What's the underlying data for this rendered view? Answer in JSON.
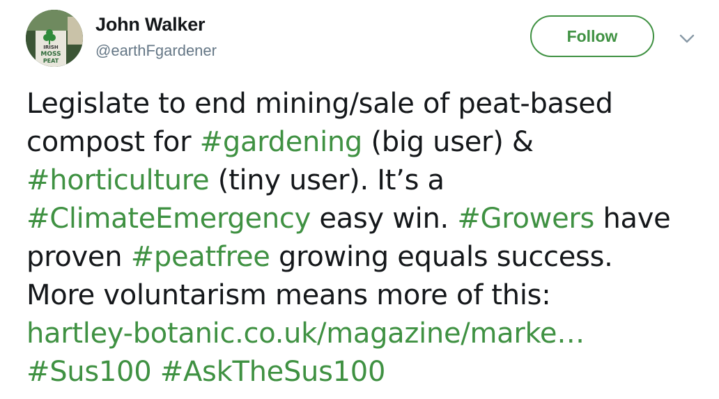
{
  "user": {
    "display_name": "John Walker",
    "handle": "@earthFgardener",
    "avatar_text": [
      "IRISH",
      "MOSS",
      "PEAT"
    ]
  },
  "actions": {
    "follow_label": "Follow",
    "menu_icon": "chevron-down-icon"
  },
  "tweet": {
    "lines": [
      [
        {
          "t": "Legislate to end mining/sale of peat-based"
        }
      ],
      [
        {
          "t": "compost for "
        },
        {
          "t": "#gardening",
          "tag": true
        },
        {
          "t": " (big user) &"
        }
      ],
      [
        {
          "t": "#horticulture",
          "tag": true
        },
        {
          "t": " (tiny user). It’s a"
        }
      ],
      [
        {
          "t": "#ClimateEmergency",
          "tag": true
        },
        {
          "t": " easy win. "
        },
        {
          "t": "#Growers",
          "tag": true
        },
        {
          "t": " have"
        }
      ],
      [
        {
          "t": "proven "
        },
        {
          "t": "#peatfree",
          "tag": true
        },
        {
          "t": " growing equals success."
        }
      ],
      [
        {
          "t": "More voluntarism means more of this:"
        }
      ],
      [
        {
          "t": "hartley-botanic.co.uk/magazine/marke…",
          "link": true
        }
      ],
      [
        {
          "t": "#Sus100",
          "tag": true
        },
        {
          "t": " "
        },
        {
          "t": "#AskTheSus100",
          "tag": true
        }
      ]
    ]
  },
  "colors": {
    "accent": "#3f9142",
    "text": "#14171a",
    "secondary": "#657786"
  }
}
